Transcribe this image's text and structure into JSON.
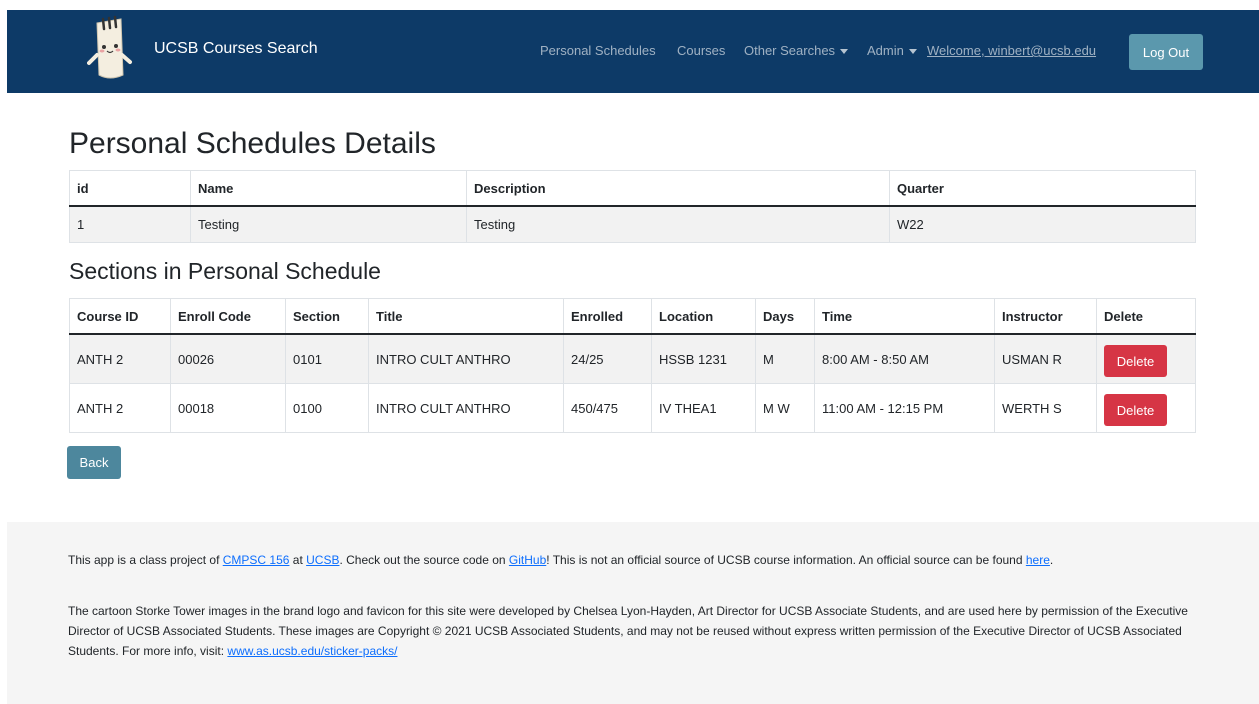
{
  "navbar": {
    "brand_text": "UCSB Courses Search",
    "links": {
      "personal_schedules": "Personal Schedules",
      "courses": "Courses",
      "other_searches": "Other Searches",
      "admin": "Admin",
      "welcome": "Welcome, winbert@ucsb.edu"
    },
    "logout_label": "Log Out"
  },
  "page_title": "Personal Schedules Details",
  "details_table": {
    "headers": [
      "id",
      "Name",
      "Description",
      "Quarter"
    ],
    "rows": [
      [
        "1",
        "Testing",
        "Testing",
        "W22"
      ]
    ]
  },
  "sections_title": "Sections in Personal Schedule",
  "sections_table": {
    "headers": [
      "Course ID",
      "Enroll Code",
      "Section",
      "Title",
      "Enrolled",
      "Location",
      "Days",
      "Time",
      "Instructor",
      "Delete"
    ],
    "rows": [
      [
        "ANTH 2",
        "00026",
        "0101",
        "INTRO CULT ANTHRO",
        "24/25",
        "HSSB 1231",
        "M",
        "8:00 AM - 8:50 AM",
        "USMAN R"
      ],
      [
        "ANTH 2",
        "00018",
        "0100",
        "INTRO CULT ANTHRO",
        "450/475",
        "IV THEA1",
        "M W",
        "11:00 AM - 12:15 PM",
        "WERTH S"
      ]
    ],
    "delete_label": "Delete"
  },
  "back_label": "Back",
  "footer": {
    "p1": {
      "t1": "This app is a class project of ",
      "link_cmpsc": "CMPSC 156",
      "t2": " at ",
      "link_ucsb": "UCSB",
      "t3": ". Check out the source code on ",
      "link_github": "GitHub",
      "t4": "! This is not an official source of UCSB course information. An official source can be found ",
      "link_here": "here",
      "t5": "."
    },
    "p2": {
      "text": "The cartoon Storke Tower images in the brand logo and favicon for this site were developed by Chelsea Lyon-Hayden, Art Director for UCSB Associate Students, and are used here by permission of the Executive Director of UCSB Associated Students. These images are Copyright © 2021 UCSB Associated Students, and may not be reused without express written permission of the Executive Director of UCSB Associated Students. For more info, visit: ",
      "link": "www.as.ucsb.edu/sticker-packs/"
    }
  }
}
